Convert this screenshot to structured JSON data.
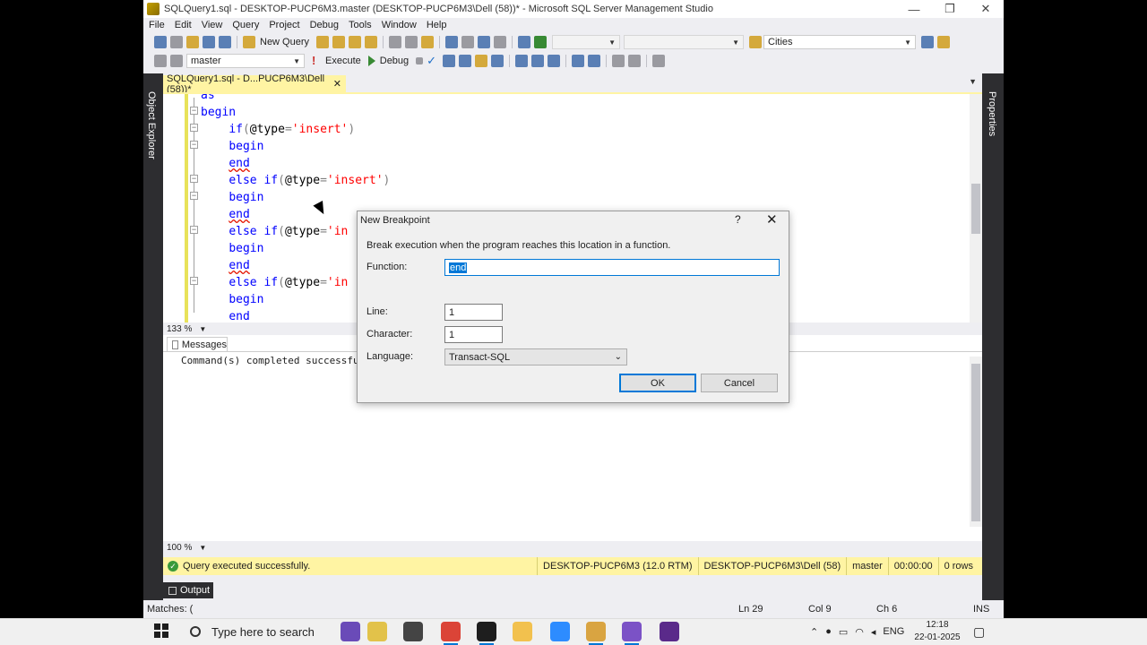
{
  "window": {
    "title": "SQLQuery1.sql - DESKTOP-PUCP6M3.master (DESKTOP-PUCP6M3\\Dell (58))* - Microsoft SQL Server Management Studio",
    "minimize": "—",
    "maximize": "❐",
    "close": "✕"
  },
  "menu": [
    "File",
    "Edit",
    "View",
    "Query",
    "Project",
    "Debug",
    "Tools",
    "Window",
    "Help"
  ],
  "toolbar1": {
    "new_query_label": "New Query",
    "solution_combo": "Cities"
  },
  "toolbar2": {
    "database_combo": "master",
    "execute_label": "Execute",
    "debug_label": "Debug"
  },
  "side_panels": {
    "left": "Object Explorer",
    "right": "Properties"
  },
  "document_tab": {
    "label": "SQLQuery1.sql - D...PUCP6M3\\Dell (58))*",
    "close": "✕"
  },
  "editor": {
    "zoom": "133 %",
    "lines": [
      {
        "indent": "",
        "parts": [
          {
            "t": "as",
            "c": "kw"
          }
        ]
      },
      {
        "indent": "",
        "parts": [
          {
            "t": "begin",
            "c": "kw"
          }
        ]
      },
      {
        "indent": "    ",
        "parts": [
          {
            "t": "if",
            "c": "kw"
          },
          {
            "t": "(",
            "c": "gray"
          },
          {
            "t": "@type",
            "c": ""
          },
          {
            "t": "=",
            "c": "gray"
          },
          {
            "t": "'insert'",
            "c": "str"
          },
          {
            "t": ")",
            "c": "gray"
          }
        ]
      },
      {
        "indent": "    ",
        "parts": [
          {
            "t": "begin",
            "c": "kw"
          }
        ]
      },
      {
        "indent": "    ",
        "parts": [
          {
            "t": "end",
            "c": "kw squig"
          }
        ]
      },
      {
        "indent": "    ",
        "parts": [
          {
            "t": "else if",
            "c": "kw"
          },
          {
            "t": "(",
            "c": "gray"
          },
          {
            "t": "@type",
            "c": ""
          },
          {
            "t": "=",
            "c": "gray"
          },
          {
            "t": "'insert'",
            "c": "str"
          },
          {
            "t": ")",
            "c": "gray"
          }
        ]
      },
      {
        "indent": "    ",
        "parts": [
          {
            "t": "begin",
            "c": "kw"
          }
        ]
      },
      {
        "indent": "    ",
        "parts": [
          {
            "t": "end",
            "c": "kw squig"
          }
        ]
      },
      {
        "indent": "    ",
        "parts": [
          {
            "t": "else if",
            "c": "kw"
          },
          {
            "t": "(",
            "c": "gray"
          },
          {
            "t": "@type",
            "c": ""
          },
          {
            "t": "=",
            "c": "gray"
          },
          {
            "t": "'in",
            "c": "str"
          }
        ]
      },
      {
        "indent": "    ",
        "parts": [
          {
            "t": "begin",
            "c": "kw"
          }
        ]
      },
      {
        "indent": "    ",
        "parts": [
          {
            "t": "end",
            "c": "kw squig"
          }
        ]
      },
      {
        "indent": "    ",
        "parts": [
          {
            "t": "else if",
            "c": "kw"
          },
          {
            "t": "(",
            "c": "gray"
          },
          {
            "t": "@type",
            "c": ""
          },
          {
            "t": "=",
            "c": "gray"
          },
          {
            "t": "'in",
            "c": "str"
          }
        ]
      },
      {
        "indent": "    ",
        "parts": [
          {
            "t": "begin",
            "c": "kw"
          }
        ]
      },
      {
        "indent": "    ",
        "parts": [
          {
            "t": "end",
            "c": "kw"
          }
        ]
      }
    ]
  },
  "results": {
    "tab_label": "Messages",
    "message": "Command(s) completed successfully.",
    "zoom": "100 %"
  },
  "query_status": {
    "text": "Query executed successfully.",
    "server": "DESKTOP-PUCP6M3 (12.0 RTM)",
    "user": "DESKTOP-PUCP6M3\\Dell (58)",
    "database": "master",
    "elapsed": "00:00:00",
    "rows": "0 rows",
    "color": "#fff4a3"
  },
  "output_tab": "Output",
  "app_status": {
    "left": "Matches: (",
    "ln": "Ln 29",
    "col": "Col 9",
    "ch": "Ch 6",
    "mode": "INS"
  },
  "dialog": {
    "title": "New Breakpoint",
    "help": "?",
    "close": "✕",
    "description": "Break execution when the program reaches this location in a function.",
    "function_label": "Function:",
    "function_value": "end",
    "line_label": "Line:",
    "line_value": "1",
    "character_label": "Character:",
    "character_value": "1",
    "language_label": "Language:",
    "language_value": "Transact-SQL",
    "ok_label": "OK",
    "cancel_label": "Cancel"
  },
  "taskbar": {
    "search_placeholder": "Type here to search",
    "apps": [
      {
        "name": "media-app",
        "color": "#6a4bb8"
      },
      {
        "name": "notes-app",
        "color": "#e2c24a"
      },
      {
        "name": "task-view",
        "color": "#444444"
      },
      {
        "name": "chrome",
        "color": "#db4437"
      },
      {
        "name": "terminal",
        "color": "#1e1e1e"
      },
      {
        "name": "file-explorer",
        "color": "#f2c14e"
      },
      {
        "name": "zoom",
        "color": "#2d8cff"
      },
      {
        "name": "ssms",
        "color": "#d9a441"
      },
      {
        "name": "visual-studio",
        "color": "#7b52c6"
      },
      {
        "name": "media-player",
        "color": "#5a2a8a"
      }
    ],
    "lang": "ENG",
    "time": "12:18",
    "date": "22-01-2025"
  }
}
